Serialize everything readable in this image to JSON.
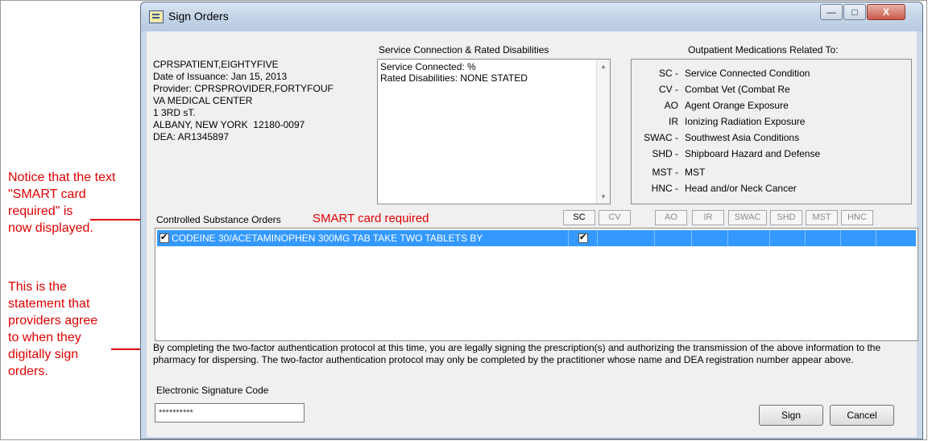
{
  "annotations": {
    "note1": [
      "Notice that the text",
      "\"SMART card",
      "required\" is",
      "now displayed."
    ],
    "note2": [
      "This is the",
      "statement that",
      "providers agree",
      "to when they",
      "digitally sign",
      "orders."
    ]
  },
  "window": {
    "title": "Sign Orders",
    "controls": {
      "minimize": "—",
      "maximize": "□",
      "close": "X"
    }
  },
  "patient": {
    "lines": [
      "CPRSPATIENT,EIGHTYFIVE",
      "Date of Issuance: Jan 15, 2013",
      "Provider: CPRSPROVIDER,FORTYFOUF",
      "VA MEDICAL CENTER",
      "1 3RD sT.",
      "ALBANY, NEW YORK  12180-0097",
      "DEA: AR1345897"
    ]
  },
  "service_connection": {
    "title": "Service Connection & Rated Disabilities",
    "lines": [
      "Service Connected: %",
      "Rated Disabilities: NONE STATED"
    ]
  },
  "outpatient": {
    "title": "Outpatient Medications Related To:",
    "items": [
      {
        "code": "SC -",
        "desc": "Service Connected Condition"
      },
      {
        "code": "CV -",
        "desc": "Combat Vet (Combat Re"
      },
      {
        "code": "AO",
        "desc": "Agent Orange Exposure"
      },
      {
        "code": "IR",
        "desc": "Ionizing Radiation Exposure"
      },
      {
        "code": "SWAC -",
        "desc": "Southwest Asia Conditions"
      },
      {
        "code": "SHD -",
        "desc": "Shipboard Hazard and Defense"
      },
      {
        "code": "MST -",
        "desc": "MST"
      },
      {
        "code": "HNC -",
        "desc": "Head and/or Neck Cancer"
      }
    ]
  },
  "orders": {
    "label": "Controlled Substance Orders",
    "smart_notice": "SMART card required",
    "columns": [
      "SC",
      "CV",
      "AO",
      "IR",
      "SWAC",
      "SHD",
      "MST",
      "HNC"
    ],
    "rows": [
      {
        "text": "CODEINE 30/ACETAMINOPHEN 300MG TAB  TAKE TWO TABLETS BY",
        "checked": true,
        "sc_checked": true
      }
    ]
  },
  "statement": "By completing the two-factor authentication protocol at this time, you are legally signing the prescription(s) and authorizing the transmission of the above information to the pharmacy for dispersing.  The two-factor authentication protocol may only be completed by the practitioner whose name and DEA registration number appear above.",
  "signature": {
    "label": "Electronic Signature Code",
    "value": "**********"
  },
  "buttons": {
    "sign": "Sign",
    "cancel": "Cancel"
  },
  "colors": {
    "annotation": "#e00000",
    "selection": "#3399ff"
  }
}
